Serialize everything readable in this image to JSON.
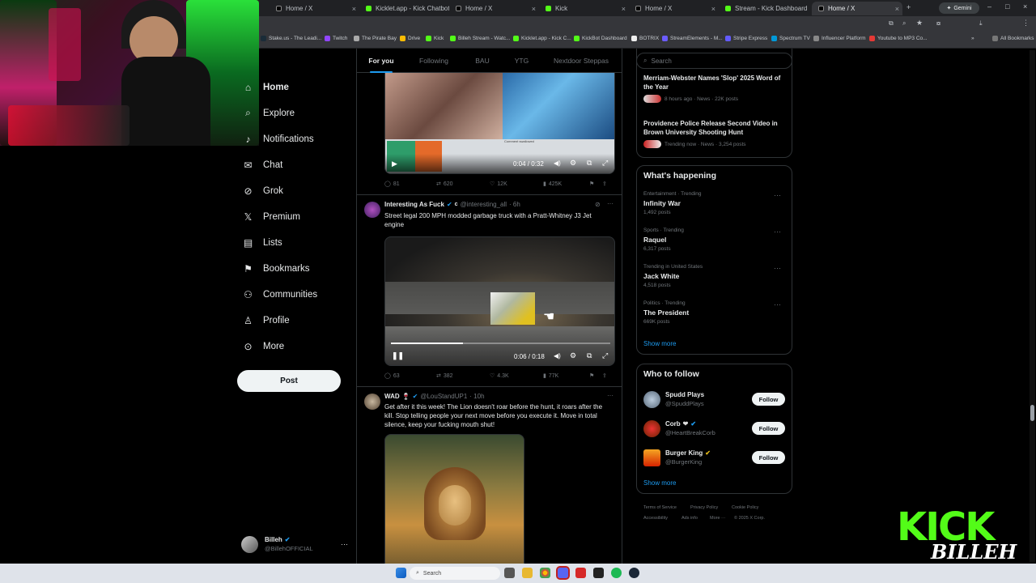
{
  "browser": {
    "tabs": [
      {
        "label": "Home / X"
      },
      {
        "label": "Kicklet.app - Kick Chatbot a..."
      },
      {
        "label": "Home / X"
      },
      {
        "label": "Kick"
      },
      {
        "label": "Home / X"
      },
      {
        "label": "Stream - Kick Dashboard"
      },
      {
        "label": "Home / X"
      }
    ],
    "gemini_label": "Gemini",
    "bookmarks": [
      "Stake.us - The Leadi...",
      "Twitch",
      "The Pirate Bay",
      "Drive",
      "Kick",
      "Billeh Stream - Watc...",
      "Kicklet.app - Kick C...",
      "KickBot Dashboard",
      "BOTRIX",
      "StreamElements - M...",
      "Stripe Express",
      "Spectrum TV",
      "Influencer Platform",
      "Youtube to MP3 Co..."
    ],
    "all_bookmarks": "All Bookmarks"
  },
  "sidebar": {
    "items": [
      {
        "label": "Home",
        "icon": "home-icon"
      },
      {
        "label": "Explore",
        "icon": "search-icon"
      },
      {
        "label": "Notifications",
        "icon": "bell-icon"
      },
      {
        "label": "Chat",
        "icon": "mail-icon"
      },
      {
        "label": "Grok",
        "icon": "grok-icon"
      },
      {
        "label": "Premium",
        "icon": "x-logo-icon"
      },
      {
        "label": "Lists",
        "icon": "list-icon"
      },
      {
        "label": "Bookmarks",
        "icon": "bookmark-icon"
      },
      {
        "label": "Communities",
        "icon": "communities-icon"
      },
      {
        "label": "Profile",
        "icon": "person-icon"
      },
      {
        "label": "More",
        "icon": "more-circle-icon"
      }
    ],
    "post_label": "Post",
    "account": {
      "name": "Billeh",
      "handle": "@BillehOFFICIAL"
    }
  },
  "feed": {
    "tabs": [
      "For you",
      "Following",
      "BAU",
      "YTG",
      "Nextdoor Steppas"
    ],
    "post1": {
      "video_time": "0:04 / 0:32",
      "inner_caption": "Comment swallowed",
      "replies": "81",
      "reposts": "620",
      "likes": "12K",
      "views": "425K"
    },
    "post2": {
      "name": "Interesting As Fuck",
      "badge": "c",
      "handle": "@interesting_all",
      "time": "· 6h",
      "text": "Street legal 200 MPH modded garbage truck with a Pratt-Whitney J3 Jet engine",
      "video_time": "0:06 / 0:18",
      "progress": 0.33,
      "replies": "63",
      "reposts": "382",
      "likes": "4.3K",
      "views": "77K"
    },
    "post3": {
      "name": "WAD",
      "emoji": "🍷",
      "handle": "@LouStandUP1",
      "time": "· 10h",
      "text": "Get after it this week! The Lion doesn't roar before the hunt, it roars after the kill. Stop telling people your next move before you execute it. Move in total silence, keep your fucking mouth shut!"
    }
  },
  "right": {
    "search_placeholder": "Search",
    "news": [
      {
        "title": "Merriam-Webster Names 'Slop' 2025 Word of the Year",
        "meta": "8 hours ago · News · 22K posts"
      },
      {
        "title": "Providence Police Release Second Video in Brown University Shooting Hunt",
        "meta": "Trending now · News · 3,254 posts"
      }
    ],
    "whats_happening": "What's happening",
    "trends": [
      {
        "context": "Entertainment · Trending",
        "title": "Infinity War",
        "posts": "1,492 posts"
      },
      {
        "context": "Sports · Trending",
        "title": "Raquel",
        "posts": "6,317 posts"
      },
      {
        "context": "Trending in United States",
        "title": "Jack White",
        "posts": "4,518 posts"
      },
      {
        "context": "Politics · Trending",
        "title": "The President",
        "posts": "669K posts"
      }
    ],
    "show_more": "Show more",
    "who_to_follow": "Who to follow",
    "follow_suggestions": [
      {
        "name": "Spudd Plays",
        "handle": "@SpuddPlays"
      },
      {
        "name": "Corb",
        "handle": "@HeartBreakCorb"
      },
      {
        "name": "Burger King",
        "handle": "@BurgerKing"
      }
    ],
    "follow_label": "Follow",
    "show_more_2": "Show more",
    "footer": [
      "Terms of Service",
      "Privacy Policy",
      "Cookie Policy",
      "Accessibility",
      "Ads info",
      "More ···",
      "© 2025 X Corp."
    ]
  },
  "overlay": {
    "kick": "KICK",
    "billeh": "BILLEH"
  },
  "taskbar": {
    "search": "Search"
  }
}
